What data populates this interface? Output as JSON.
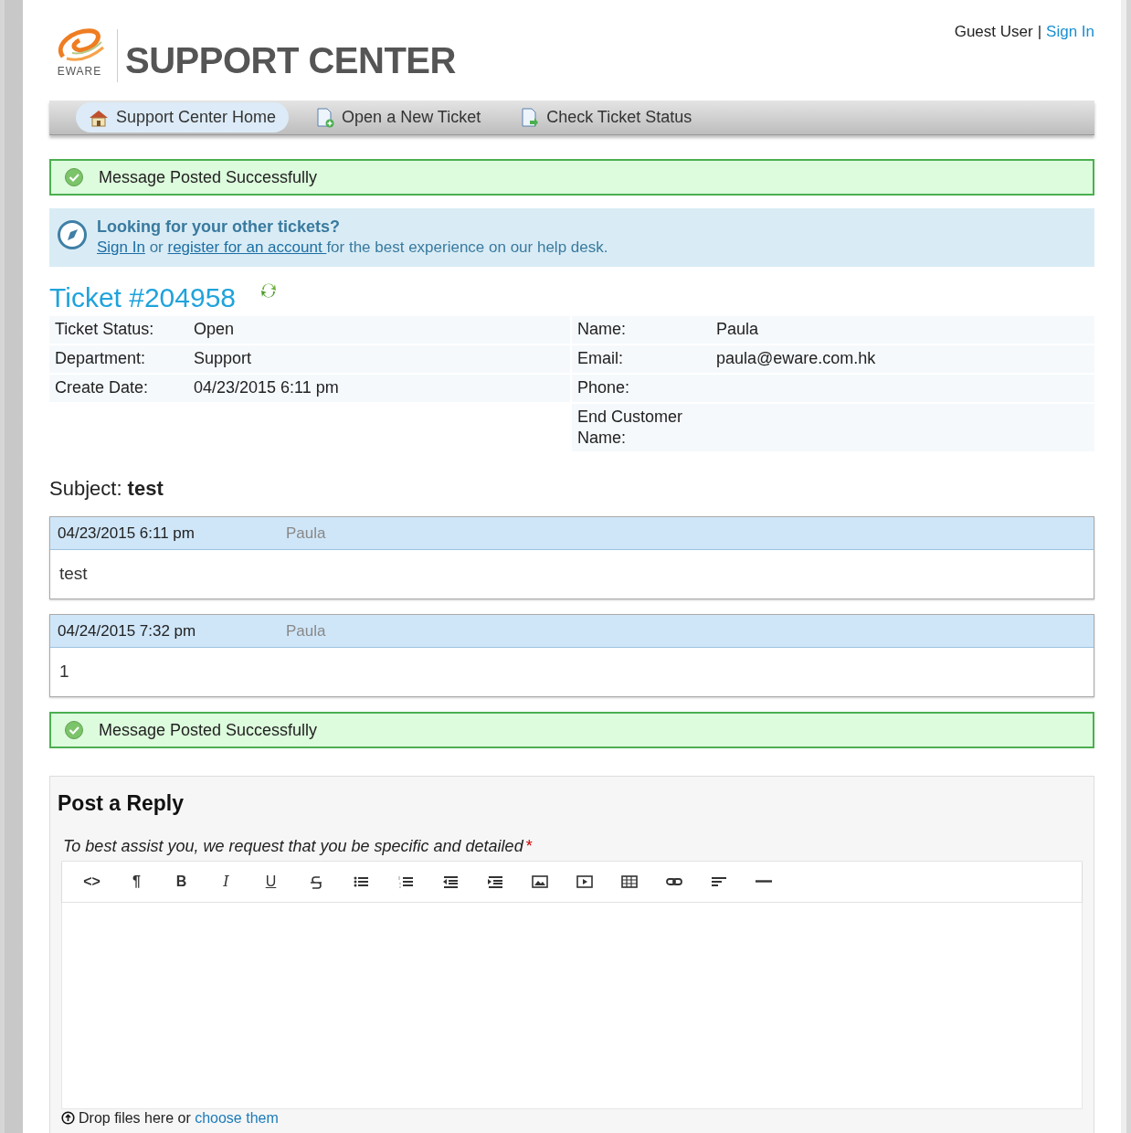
{
  "header": {
    "logo_text": "EWARE",
    "title": "SUPPORT CENTER",
    "user": "Guest User",
    "separator": "|",
    "sign_in": "Sign In"
  },
  "nav": [
    {
      "label": "Support Center Home",
      "selected": true
    },
    {
      "label": "Open a New Ticket",
      "selected": false
    },
    {
      "label": "Check Ticket Status",
      "selected": false
    }
  ],
  "notice_top": "Message Posted Successfully",
  "info": {
    "title": "Looking for your other tickets?",
    "sign_in": "Sign In",
    "or": "or",
    "register": "register for an account ",
    "rest": "for the best experience on our help desk."
  },
  "ticket": {
    "title": "Ticket #204958",
    "left": [
      {
        "label": "Ticket Status:",
        "value": "Open"
      },
      {
        "label": "Department:",
        "value": "Support"
      },
      {
        "label": "Create Date:",
        "value": "04/23/2015 6:11 pm"
      }
    ],
    "right": [
      {
        "label": "Name:",
        "value": "Paula"
      },
      {
        "label": "Email:",
        "value": "paula@eware.com.hk"
      },
      {
        "label": "Phone:"
      },
      {
        "label": "End Customer Name:"
      }
    ]
  },
  "subject": "Subject: **test**",
  "thread": [
    {
      "date": "04/23/2015 6:11 pm",
      "poster": "Paula",
      "body": "test"
    },
    {
      "date": "04/24/2015 7:32 pm",
      "poster": "Paula",
      "body": "1"
    }
  ],
  "notice_bottom": "Message Posted Successfully",
  "reply": {
    "title": "Post a Reply",
    "hint": "To best assist you, we request that you be specific and detailed",
    "required": "*",
    "toolbar": [
      {
        "kind": "text",
        "label": "<>"
      },
      {
        "kind": "text",
        "label": "¶"
      },
      {
        "kind": "bold",
        "label": "B"
      },
      {
        "kind": "italic",
        "label": "I"
      },
      {
        "kind": "underline",
        "label": "U"
      },
      {
        "kind": "strike"
      },
      {
        "kind": "ul"
      },
      {
        "kind": "ol"
      },
      {
        "kind": "outdent"
      },
      {
        "kind": "indent"
      },
      {
        "kind": "image"
      },
      {
        "kind": "video"
      },
      {
        "kind": "table"
      },
      {
        "kind": "link"
      },
      {
        "kind": "align"
      },
      {
        "kind": "rule"
      }
    ],
    "drop_text": "Drop files here or",
    "drop_link": "choose them"
  }
}
